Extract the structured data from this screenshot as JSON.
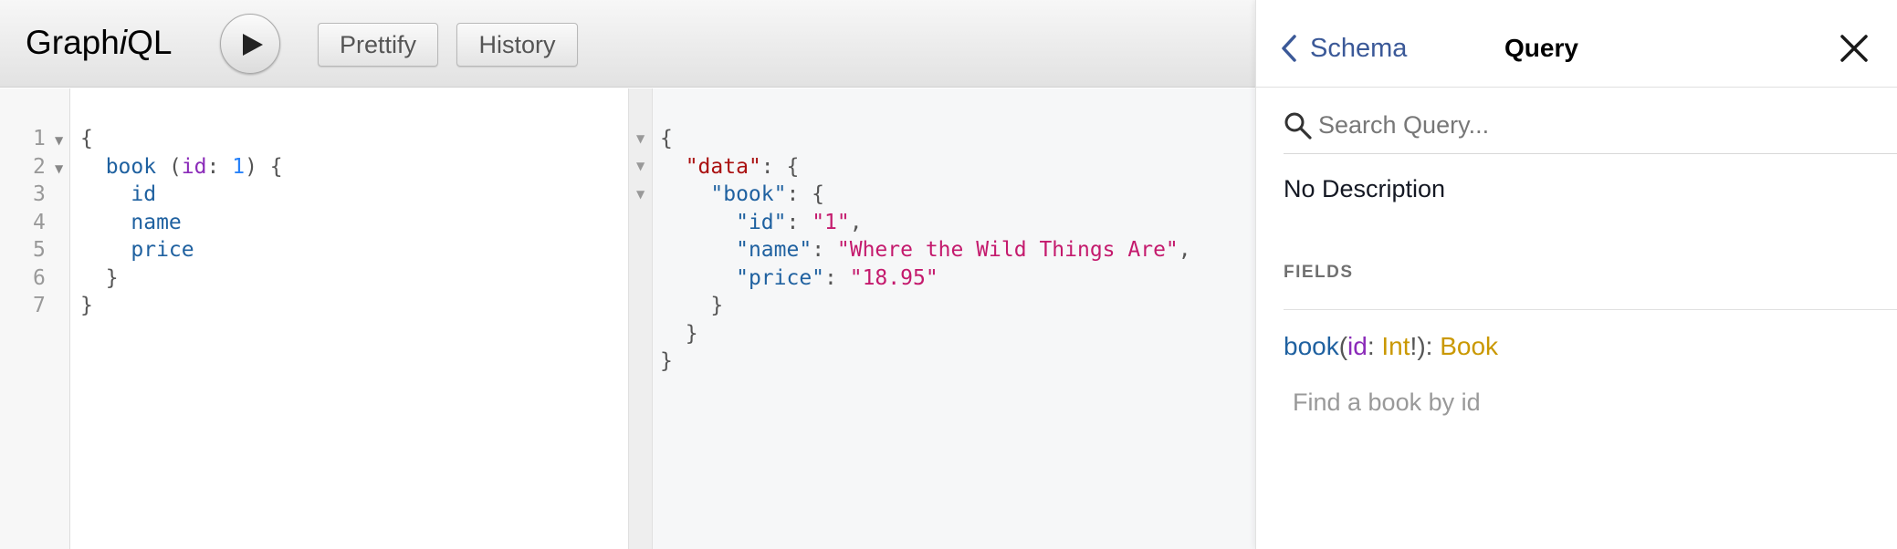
{
  "app": {
    "logo_prefix": "Graph",
    "logo_italic": "i",
    "logo_suffix": "QL",
    "prettify_label": "Prettify",
    "history_label": "History"
  },
  "query_editor": {
    "line_numbers": [
      "1",
      "2",
      "3",
      "4",
      "5",
      "6",
      "7"
    ],
    "line1": "{",
    "line2_field": "book",
    "line2_paren_open": " (",
    "line2_arg": "id",
    "line2_colon": ": ",
    "line2_value": "1",
    "line2_tail": ") {",
    "line3": "id",
    "line4": "name",
    "line5": "price",
    "line6": "}",
    "line7": "}"
  },
  "result": {
    "open": "{",
    "data_key": "\"data\"",
    "book_key": "\"book\"",
    "id_key": "\"id\"",
    "id_value": "\"1\"",
    "name_key": "\"name\"",
    "name_value": "\"Where the Wild Things Are\"",
    "price_key": "\"price\"",
    "price_value": "\"18.95\"",
    "close": "}"
  },
  "docs": {
    "back_label": "Schema",
    "title": "Query",
    "search_placeholder": "Search Query...",
    "description": "No Description",
    "fields_header": "FIELDS",
    "field_name": "book",
    "field_arg": "id",
    "field_arg_type": "Int",
    "field_arg_bang": "!",
    "field_type": "Book",
    "field_description": "Find a book by id"
  },
  "icons": {
    "execute": "play-icon",
    "back": "chevron-left-icon",
    "close": "close-icon",
    "search": "search-icon"
  },
  "colors": {
    "field": "#1f61a0",
    "argument": "#8b2bb9",
    "number": "#2882f9",
    "string": "#c41a6d",
    "type": "#ca9800",
    "link": "#3b5998"
  }
}
